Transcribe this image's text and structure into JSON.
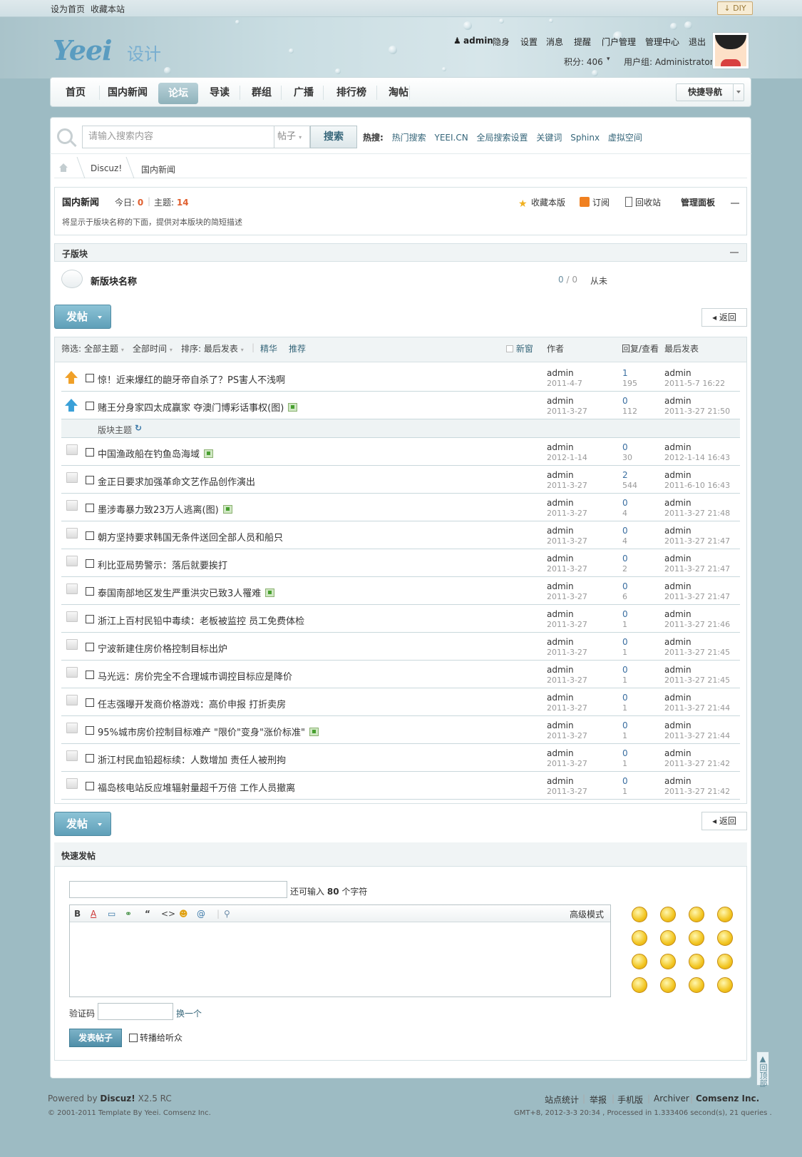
{
  "topbar": {
    "set_home": "设为首页",
    "favorite": "收藏本站",
    "diy": "DIY"
  },
  "header": {
    "logo_text": "Yeei",
    "logo_cn": "设计",
    "username": "admin",
    "invisible": "隐身",
    "menu": [
      "设置",
      "消息",
      "提醒",
      "门户管理",
      "管理中心",
      "退出"
    ],
    "credits": "积分: 406",
    "usergroup": "用户组: Administrator"
  },
  "nav": {
    "items": [
      "首页",
      "国内新闻",
      "论坛",
      "导读",
      "群组",
      "广播",
      "排行榜",
      "淘帖"
    ],
    "active_index": 2,
    "quick_nav": "快捷导航"
  },
  "search": {
    "placeholder": "请输入搜索内容",
    "type": "帖子",
    "button": "搜索",
    "hot_label": "热搜:",
    "hot_links": [
      "热门搜索",
      "YEEI.CN",
      "全局搜索设置",
      "关键词",
      "Sphinx",
      "虚拟空间"
    ]
  },
  "breadcrumb": [
    "Discuz!",
    "国内新闻"
  ],
  "forum": {
    "name": "国内新闻",
    "today_label": "今日:",
    "today": "0",
    "topics_label": "主题:",
    "topics": "14",
    "description": "将显示于版块名称的下面，提供对本版块的简短描述",
    "actions": [
      "收藏本版",
      "订阅",
      "回收站",
      "管理面板"
    ]
  },
  "subforum": {
    "header": "子版块",
    "name": "新版块名称",
    "threads": "0",
    "posts": "0",
    "last": "从未"
  },
  "buttons": {
    "post": "发帖",
    "back": "返回"
  },
  "list_header": {
    "filter_label": "筛选:",
    "all_topics": "全部主题",
    "all_time": "全部时间",
    "sort": "排序: 最后发表",
    "digest": "精华",
    "recommend": "推荐",
    "new_window": "新窗",
    "author": "作者",
    "reply_view": "回复/查看",
    "last_post": "最后发表"
  },
  "sticky_threads": [
    {
      "title": "惊！近来爆红的龅牙帝自杀了？PS害人不浅啊",
      "img": false,
      "author": "admin",
      "date": "2011-4-7",
      "replies": "1",
      "views": "195",
      "last_user": "admin",
      "last_date": "2011-5-7 16:22",
      "icon": "up"
    },
    {
      "title": "赌王分身家四太成赢家 夺澳门博彩话事权(图)",
      "img": true,
      "author": "admin",
      "date": "2011-3-27",
      "replies": "0",
      "views": "112",
      "last_user": "admin",
      "last_date": "2011-3-27 21:50",
      "icon": "up2"
    }
  ],
  "section_label": "版块主题",
  "threads": [
    {
      "title": "中国渔政船在钓鱼岛海域",
      "img": true,
      "author": "admin",
      "date": "2012-1-14",
      "replies": "0",
      "views": "30",
      "last_user": "admin",
      "last_date": "2012-1-14 16:43"
    },
    {
      "title": "金正日要求加强革命文艺作品创作演出",
      "img": false,
      "author": "admin",
      "date": "2011-3-27",
      "replies": "2",
      "views": "544",
      "last_user": "admin",
      "last_date": "2011-6-10 16:43"
    },
    {
      "title": "墨涉毒暴力致23万人逃离(图)",
      "img": true,
      "author": "admin",
      "date": "2011-3-27",
      "replies": "0",
      "views": "4",
      "last_user": "admin",
      "last_date": "2011-3-27 21:48"
    },
    {
      "title": "朝方坚持要求韩国无条件送回全部人员和船只",
      "img": false,
      "author": "admin",
      "date": "2011-3-27",
      "replies": "0",
      "views": "4",
      "last_user": "admin",
      "last_date": "2011-3-27 21:47"
    },
    {
      "title": "利比亚局势警示：落后就要挨打",
      "img": false,
      "author": "admin",
      "date": "2011-3-27",
      "replies": "0",
      "views": "2",
      "last_user": "admin",
      "last_date": "2011-3-27 21:47"
    },
    {
      "title": "泰国南部地区发生严重洪灾已致3人罹难",
      "img": true,
      "author": "admin",
      "date": "2011-3-27",
      "replies": "0",
      "views": "6",
      "last_user": "admin",
      "last_date": "2011-3-27 21:47"
    },
    {
      "title": "浙江上百村民铅中毒续：老板被监控 员工免费体检",
      "img": false,
      "author": "admin",
      "date": "2011-3-27",
      "replies": "0",
      "views": "1",
      "last_user": "admin",
      "last_date": "2011-3-27 21:46"
    },
    {
      "title": "宁波新建住房价格控制目标出炉",
      "img": false,
      "author": "admin",
      "date": "2011-3-27",
      "replies": "0",
      "views": "1",
      "last_user": "admin",
      "last_date": "2011-3-27 21:45"
    },
    {
      "title": "马光远：房价完全不合理城市调控目标应是降价",
      "img": false,
      "author": "admin",
      "date": "2011-3-27",
      "replies": "0",
      "views": "1",
      "last_user": "admin",
      "last_date": "2011-3-27 21:45"
    },
    {
      "title": "任志强曝开发商价格游戏：高价申报 打折卖房",
      "img": false,
      "author": "admin",
      "date": "2011-3-27",
      "replies": "0",
      "views": "1",
      "last_user": "admin",
      "last_date": "2011-3-27 21:44"
    },
    {
      "title": "95%城市房价控制目标难产 \"限价\"变身\"涨价标准\"",
      "img": true,
      "author": "admin",
      "date": "2011-3-27",
      "replies": "0",
      "views": "1",
      "last_user": "admin",
      "last_date": "2011-3-27 21:44"
    },
    {
      "title": "浙江村民血铅超标续：人数增加 责任人被刑拘",
      "img": false,
      "author": "admin",
      "date": "2011-3-27",
      "replies": "0",
      "views": "1",
      "last_user": "admin",
      "last_date": "2011-3-27 21:42"
    },
    {
      "title": "福岛核电站反应堆辐射量超千万倍 工作人员撤离",
      "img": false,
      "author": "admin",
      "date": "2011-3-27",
      "replies": "0",
      "views": "1",
      "last_user": "admin",
      "last_date": "2011-3-27 21:42"
    }
  ],
  "fastpost": {
    "header": "快速发帖",
    "remain_prefix": "还可输入",
    "remain_count": "80",
    "remain_suffix": "个字符",
    "advanced": "高级模式",
    "toolbar": [
      "B",
      "A",
      "▭",
      "⚭",
      "“",
      "<>",
      "☻",
      "@",
      "|",
      "⚲"
    ],
    "captcha_label": "验证码",
    "change": "换一个",
    "submit": "发表帖子",
    "relay": "转播给听众"
  },
  "backtop": "回顶部",
  "footer": {
    "powered": "Powered by",
    "product": "Discuz!",
    "version": "X2.5 RC",
    "copyright": "© 2001-2011 Template By Yeei. Comsenz Inc.",
    "links": [
      "站点统计",
      "举报",
      "手机版",
      "Archiver",
      "Comsenz Inc."
    ],
    "process": "GMT+8, 2012-3-3 20:34 , Processed in 1.333406 second(s), 21 queries ."
  }
}
